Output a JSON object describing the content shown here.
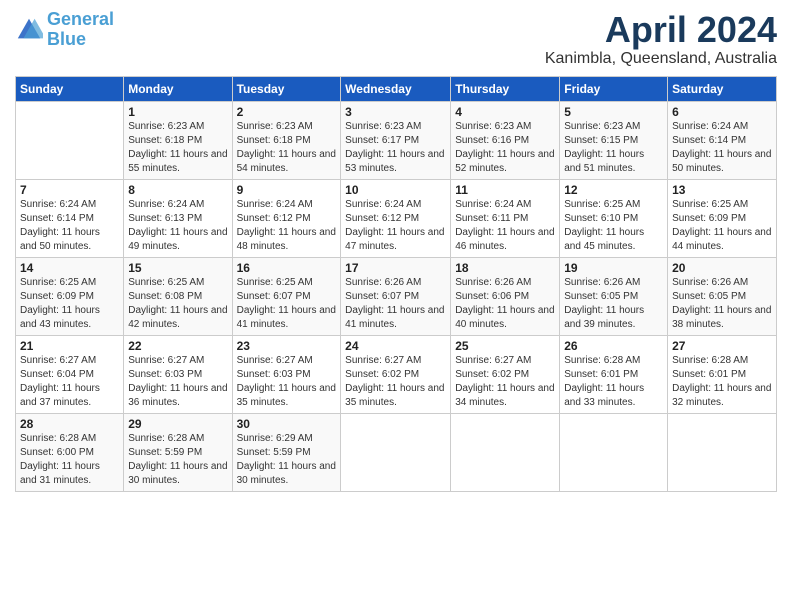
{
  "logo": {
    "line1": "General",
    "line2": "Blue"
  },
  "title": "April 2024",
  "subtitle": "Kanimbla, Queensland, Australia",
  "days_header": [
    "Sunday",
    "Monday",
    "Tuesday",
    "Wednesday",
    "Thursday",
    "Friday",
    "Saturday"
  ],
  "weeks": [
    [
      {
        "day": "",
        "sunrise": "",
        "sunset": "",
        "daylight": ""
      },
      {
        "day": "1",
        "sunrise": "Sunrise: 6:23 AM",
        "sunset": "Sunset: 6:18 PM",
        "daylight": "Daylight: 11 hours and 55 minutes."
      },
      {
        "day": "2",
        "sunrise": "Sunrise: 6:23 AM",
        "sunset": "Sunset: 6:18 PM",
        "daylight": "Daylight: 11 hours and 54 minutes."
      },
      {
        "day": "3",
        "sunrise": "Sunrise: 6:23 AM",
        "sunset": "Sunset: 6:17 PM",
        "daylight": "Daylight: 11 hours and 53 minutes."
      },
      {
        "day": "4",
        "sunrise": "Sunrise: 6:23 AM",
        "sunset": "Sunset: 6:16 PM",
        "daylight": "Daylight: 11 hours and 52 minutes."
      },
      {
        "day": "5",
        "sunrise": "Sunrise: 6:23 AM",
        "sunset": "Sunset: 6:15 PM",
        "daylight": "Daylight: 11 hours and 51 minutes."
      },
      {
        "day": "6",
        "sunrise": "Sunrise: 6:24 AM",
        "sunset": "Sunset: 6:14 PM",
        "daylight": "Daylight: 11 hours and 50 minutes."
      }
    ],
    [
      {
        "day": "7",
        "sunrise": "Sunrise: 6:24 AM",
        "sunset": "Sunset: 6:14 PM",
        "daylight": "Daylight: 11 hours and 50 minutes."
      },
      {
        "day": "8",
        "sunrise": "Sunrise: 6:24 AM",
        "sunset": "Sunset: 6:13 PM",
        "daylight": "Daylight: 11 hours and 49 minutes."
      },
      {
        "day": "9",
        "sunrise": "Sunrise: 6:24 AM",
        "sunset": "Sunset: 6:12 PM",
        "daylight": "Daylight: 11 hours and 48 minutes."
      },
      {
        "day": "10",
        "sunrise": "Sunrise: 6:24 AM",
        "sunset": "Sunset: 6:12 PM",
        "daylight": "Daylight: 11 hours and 47 minutes."
      },
      {
        "day": "11",
        "sunrise": "Sunrise: 6:24 AM",
        "sunset": "Sunset: 6:11 PM",
        "daylight": "Daylight: 11 hours and 46 minutes."
      },
      {
        "day": "12",
        "sunrise": "Sunrise: 6:25 AM",
        "sunset": "Sunset: 6:10 PM",
        "daylight": "Daylight: 11 hours and 45 minutes."
      },
      {
        "day": "13",
        "sunrise": "Sunrise: 6:25 AM",
        "sunset": "Sunset: 6:09 PM",
        "daylight": "Daylight: 11 hours and 44 minutes."
      }
    ],
    [
      {
        "day": "14",
        "sunrise": "Sunrise: 6:25 AM",
        "sunset": "Sunset: 6:09 PM",
        "daylight": "Daylight: 11 hours and 43 minutes."
      },
      {
        "day": "15",
        "sunrise": "Sunrise: 6:25 AM",
        "sunset": "Sunset: 6:08 PM",
        "daylight": "Daylight: 11 hours and 42 minutes."
      },
      {
        "day": "16",
        "sunrise": "Sunrise: 6:25 AM",
        "sunset": "Sunset: 6:07 PM",
        "daylight": "Daylight: 11 hours and 41 minutes."
      },
      {
        "day": "17",
        "sunrise": "Sunrise: 6:26 AM",
        "sunset": "Sunset: 6:07 PM",
        "daylight": "Daylight: 11 hours and 41 minutes."
      },
      {
        "day": "18",
        "sunrise": "Sunrise: 6:26 AM",
        "sunset": "Sunset: 6:06 PM",
        "daylight": "Daylight: 11 hours and 40 minutes."
      },
      {
        "day": "19",
        "sunrise": "Sunrise: 6:26 AM",
        "sunset": "Sunset: 6:05 PM",
        "daylight": "Daylight: 11 hours and 39 minutes."
      },
      {
        "day": "20",
        "sunrise": "Sunrise: 6:26 AM",
        "sunset": "Sunset: 6:05 PM",
        "daylight": "Daylight: 11 hours and 38 minutes."
      }
    ],
    [
      {
        "day": "21",
        "sunrise": "Sunrise: 6:27 AM",
        "sunset": "Sunset: 6:04 PM",
        "daylight": "Daylight: 11 hours and 37 minutes."
      },
      {
        "day": "22",
        "sunrise": "Sunrise: 6:27 AM",
        "sunset": "Sunset: 6:03 PM",
        "daylight": "Daylight: 11 hours and 36 minutes."
      },
      {
        "day": "23",
        "sunrise": "Sunrise: 6:27 AM",
        "sunset": "Sunset: 6:03 PM",
        "daylight": "Daylight: 11 hours and 35 minutes."
      },
      {
        "day": "24",
        "sunrise": "Sunrise: 6:27 AM",
        "sunset": "Sunset: 6:02 PM",
        "daylight": "Daylight: 11 hours and 35 minutes."
      },
      {
        "day": "25",
        "sunrise": "Sunrise: 6:27 AM",
        "sunset": "Sunset: 6:02 PM",
        "daylight": "Daylight: 11 hours and 34 minutes."
      },
      {
        "day": "26",
        "sunrise": "Sunrise: 6:28 AM",
        "sunset": "Sunset: 6:01 PM",
        "daylight": "Daylight: 11 hours and 33 minutes."
      },
      {
        "day": "27",
        "sunrise": "Sunrise: 6:28 AM",
        "sunset": "Sunset: 6:01 PM",
        "daylight": "Daylight: 11 hours and 32 minutes."
      }
    ],
    [
      {
        "day": "28",
        "sunrise": "Sunrise: 6:28 AM",
        "sunset": "Sunset: 6:00 PM",
        "daylight": "Daylight: 11 hours and 31 minutes."
      },
      {
        "day": "29",
        "sunrise": "Sunrise: 6:28 AM",
        "sunset": "Sunset: 5:59 PM",
        "daylight": "Daylight: 11 hours and 30 minutes."
      },
      {
        "day": "30",
        "sunrise": "Sunrise: 6:29 AM",
        "sunset": "Sunset: 5:59 PM",
        "daylight": "Daylight: 11 hours and 30 minutes."
      },
      {
        "day": "",
        "sunrise": "",
        "sunset": "",
        "daylight": ""
      },
      {
        "day": "",
        "sunrise": "",
        "sunset": "",
        "daylight": ""
      },
      {
        "day": "",
        "sunrise": "",
        "sunset": "",
        "daylight": ""
      },
      {
        "day": "",
        "sunrise": "",
        "sunset": "",
        "daylight": ""
      }
    ]
  ]
}
